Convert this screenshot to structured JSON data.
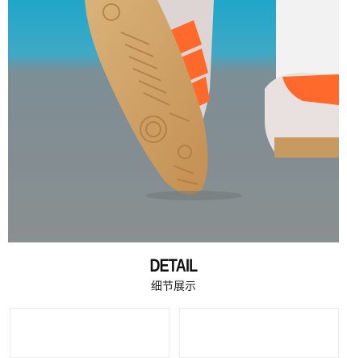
{
  "hero": {
    "image": "sneaker-sole-product-photo"
  },
  "section": {
    "title_en": "DETAIL",
    "title_cn": "细节展示"
  },
  "cards": [
    {
      "slot": "left",
      "content": ""
    },
    {
      "slot": "right",
      "content": ""
    }
  ]
}
